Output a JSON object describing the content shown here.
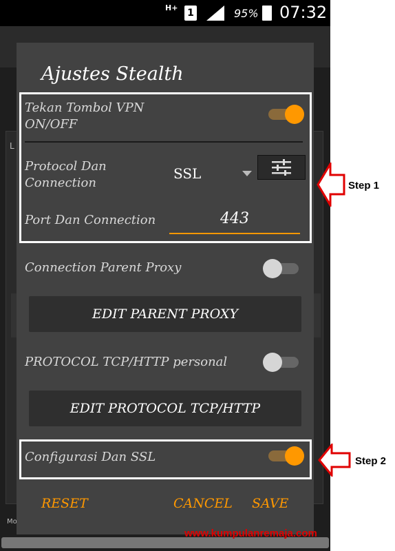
{
  "status_bar": {
    "network": "H+",
    "sim": "1",
    "battery": "95%",
    "time": "07:32"
  },
  "background": {
    "letter_l": "L",
    "letter_m": "Mo"
  },
  "dialog": {
    "title": "Ajustes Stealth",
    "vpn_toggle": {
      "label_line1": "Tekan Tombol VPN",
      "label_line2": "ON/OFF",
      "state": "on"
    },
    "protocol": {
      "label_line1": "Protocol Dan",
      "label_line2": "Connection",
      "value": "SSL"
    },
    "port": {
      "label": "Port Dan Connection",
      "value": "443"
    },
    "parent_proxy": {
      "label": "Connection Parent Proxy",
      "state": "off",
      "button": "EDIT PARENT PROXY"
    },
    "protocol_tcp": {
      "label": "PROTOCOL TCP/HTTP personal",
      "state": "off",
      "button": "EDIT PROTOCOL TCP/HTTP"
    },
    "ssl_config": {
      "label": "Configurasi Dan SSL",
      "state": "on"
    },
    "actions": {
      "reset": "RESET",
      "cancel": "CANCEL",
      "save": "SAVE"
    }
  },
  "annotations": {
    "step1": "Step 1",
    "step2": "Step 2",
    "watermark": "www.kumpulanremaja.com"
  },
  "colors": {
    "accent": "#ff9800",
    "dialog_bg": "#424242",
    "highlight": "#ffffff",
    "arrow": "#e00000"
  }
}
